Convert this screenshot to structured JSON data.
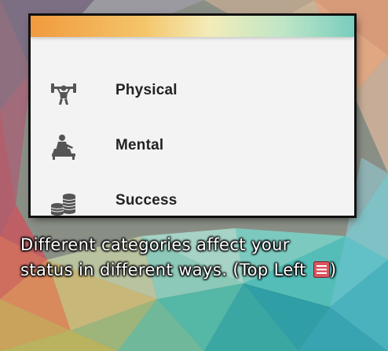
{
  "menu": {
    "items": [
      {
        "label": "Physical",
        "icon": "weightlifter-icon"
      },
      {
        "label": "Mental",
        "icon": "meditation-icon"
      },
      {
        "label": "Success",
        "icon": "coin-stack-icon"
      }
    ]
  },
  "caption": {
    "line1": "Different categories affect your",
    "line2_before_icon": "status in different ways. (Top Left ",
    "line2_after_icon": ")",
    "icon": "menu-icon"
  },
  "colors": {
    "card_background": "#f3f3f3",
    "gradient_orange": "#f19a3e",
    "gradient_teal": "#79cdbe",
    "icon_gray": "#555555",
    "inline_menu_icon": "#d9555f"
  }
}
